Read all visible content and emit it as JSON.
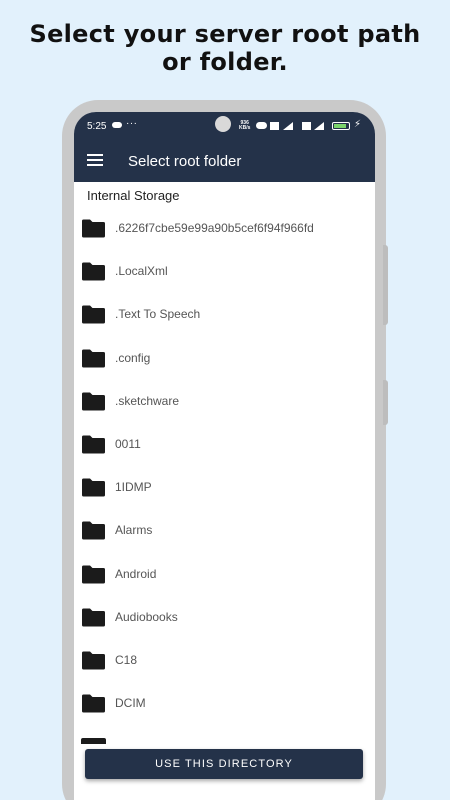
{
  "headline": {
    "line1": "Select your server root path",
    "line2": "or folder."
  },
  "status_bar": {
    "time": "5:25",
    "extra_indicator": "···",
    "net_speed_value": "936",
    "net_speed_unit": "KB/s",
    "battery_color": "#7bd36b"
  },
  "app_bar": {
    "title": "Select root folder",
    "menu_icon": "hamburger-menu-icon"
  },
  "storage_label": "Internal Storage",
  "folders": [
    ".6226f7cbe59e99a90b5cef6f94f966fd",
    ".LocalXml",
    ".Text To Speech",
    ".config",
    ".sketchware",
    "0011",
    "1IDMP",
    "Alarms",
    "Android",
    "Audiobooks",
    "C18",
    "DCIM"
  ],
  "action_button": {
    "label": "USE THIS DIRECTORY"
  },
  "colors": {
    "background": "#e2f1fc",
    "primary": "#243249",
    "folder_icon": "#1b1b1b"
  }
}
